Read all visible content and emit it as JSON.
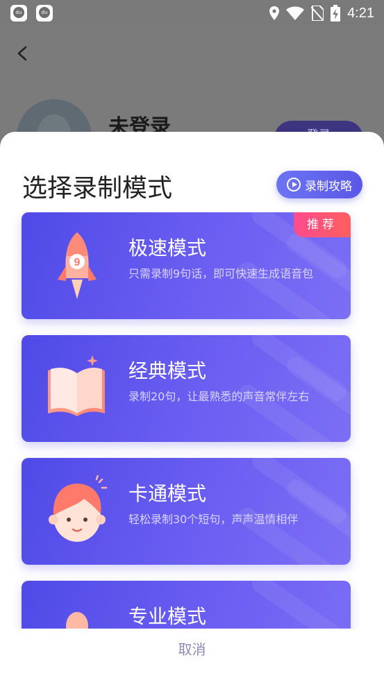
{
  "status_bar": {
    "app_icons": [
      "du",
      "du"
    ],
    "time": "4:21",
    "icons": [
      "location-icon",
      "wifi-icon",
      "no-sim-icon",
      "battery-charging-icon"
    ]
  },
  "background": {
    "user_name": "未登录",
    "login_label": "登录"
  },
  "sheet": {
    "title": "选择录制模式",
    "guide_button": "录制攻略",
    "modes": [
      {
        "title": "极速模式",
        "desc": "只需录制9句话，即可快速生成语音包",
        "badge": "推荐",
        "icon": "rocket-icon",
        "rocket_number": "9"
      },
      {
        "title": "经典模式",
        "desc": "录制20句，让最熟悉的声音常伴左右",
        "icon": "book-icon"
      },
      {
        "title": "卡通模式",
        "desc": "轻松录制30个短句，声声温情相伴",
        "icon": "cartoon-face-icon"
      },
      {
        "title": "专业模式",
        "desc": "",
        "icon": "professional-icon"
      }
    ],
    "cancel": "取消"
  },
  "colors": {
    "accent": "#5a57e6",
    "card_start": "#4f4ae6",
    "card_end": "#7c6ff5",
    "badge": "#ff4a8d",
    "cancel_text": "#8e88b8"
  }
}
